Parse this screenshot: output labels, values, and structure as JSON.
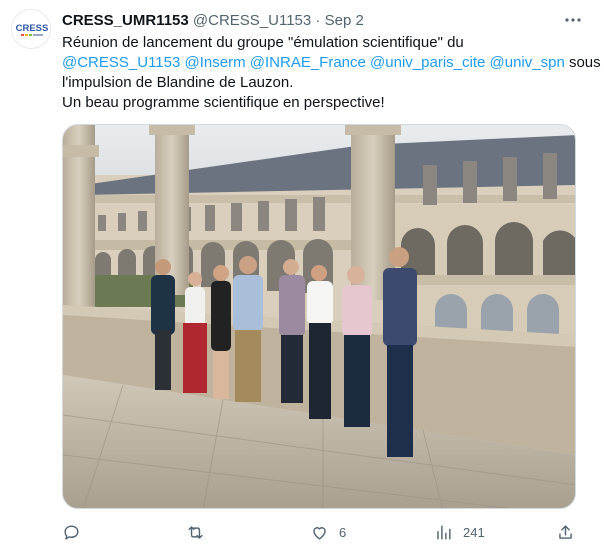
{
  "tweet": {
    "author_name": "CRESS_UMR1153",
    "handle": "@CRESS_U1153",
    "separator": "·",
    "date": "Sep 2",
    "avatar_text": "CRESS",
    "text_line1": "Réunion de lancement du groupe \"émulation scientifique\" du",
    "mention1": "@CRESS_U1153",
    "mention2": "@Inserm",
    "mention3": "@INRAE_France",
    "mention4": "@univ_paris_cite",
    "mention5": "@univ_spn",
    "text_after_mentions": "sous",
    "text_line3": "l'impulsion de Blandine de Lauzon.",
    "text_line4": "Un beau programme scientifique en perspective!"
  },
  "actions": {
    "reply_count": "",
    "retweet_count": "",
    "like_count": "6",
    "views_count": "241"
  },
  "icons": {
    "more": "more-dots-icon",
    "reply": "reply-icon",
    "retweet": "retweet-icon",
    "like": "heart-icon",
    "views": "views-chart-icon",
    "share": "share-icon"
  },
  "colors": {
    "link": "#1d9bf0",
    "secondary_text": "#536471",
    "primary_text": "#0f1419",
    "avatar_brand": "#2e5aa8"
  }
}
